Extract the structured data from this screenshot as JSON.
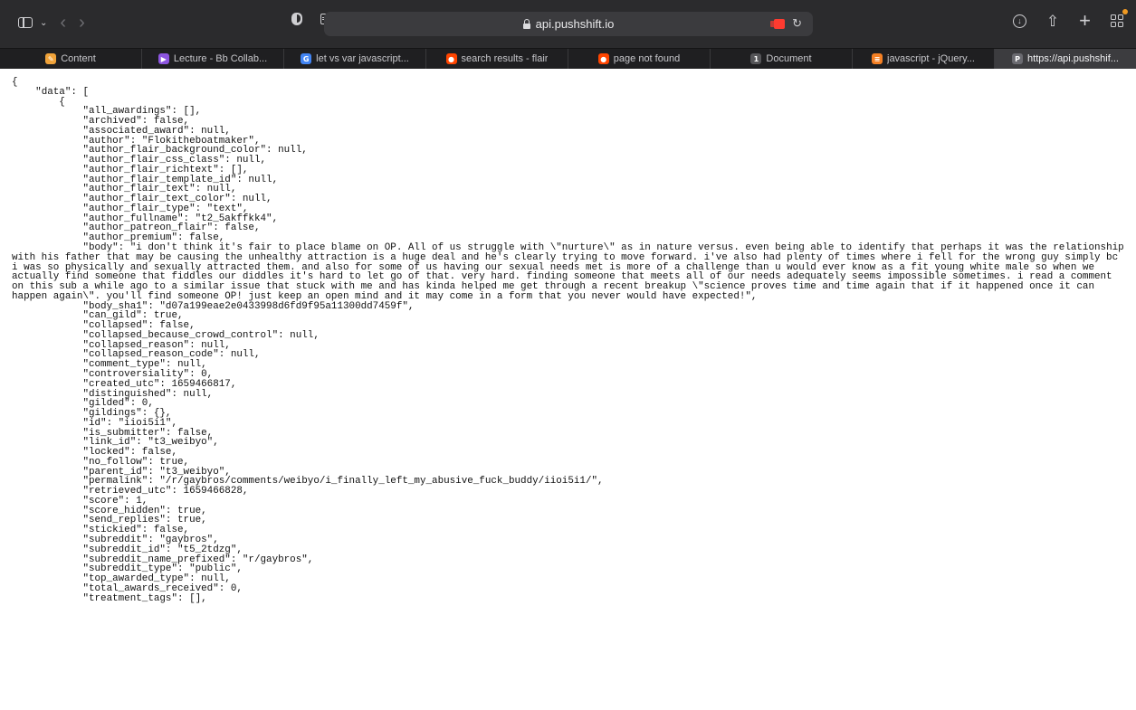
{
  "browser": {
    "url": "api.pushshift.io",
    "icons": {
      "sidebar": "sidebar-toggle-icon",
      "back": "back-arrow-icon",
      "forward": "forward-arrow-icon",
      "privacy": "shield-icon",
      "reader": "page-icon",
      "lock": "lock-icon",
      "camera": "camera-icon",
      "reload": "reload-icon",
      "download": "download-icon",
      "share": "share-icon",
      "new_tab": "plus-icon",
      "tab_overview": "grid-icon"
    },
    "glyphs": {
      "back": "‹",
      "forward": "›",
      "chevron": "⌄",
      "reload": "↻",
      "download": "↓",
      "share": "⇧",
      "plus": "+"
    }
  },
  "tabs": [
    {
      "label": "Content",
      "icon_char": "✎",
      "icon_color": "#f0a33a"
    },
    {
      "label": "Lecture - Bb Collab...",
      "icon_char": "▶",
      "icon_color": "#8d55e0"
    },
    {
      "label": "let vs var javascript...",
      "icon_char": "G",
      "icon_color": "#4285f4"
    },
    {
      "label": "search results - flair",
      "icon_char": "●",
      "icon_color": "#ff4500"
    },
    {
      "label": "page not found",
      "icon_char": "●",
      "icon_color": "#ff4500"
    },
    {
      "label": "Document",
      "icon_char": "1",
      "icon_color": "#555558"
    },
    {
      "label": "javascript - jQuery...",
      "icon_char": "≡",
      "icon_color": "#f48024"
    },
    {
      "label": "https://api.pushshif...",
      "icon_char": "P",
      "icon_color": "#6a6a70"
    }
  ],
  "active_tab_index": 7,
  "json_text": "{\n    \"data\": [\n        {\n            \"all_awardings\": [],\n            \"archived\": false,\n            \"associated_award\": null,\n            \"author\": \"Flokitheboatmaker\",\n            \"author_flair_background_color\": null,\n            \"author_flair_css_class\": null,\n            \"author_flair_richtext\": [],\n            \"author_flair_template_id\": null,\n            \"author_flair_text\": null,\n            \"author_flair_text_color\": null,\n            \"author_flair_type\": \"text\",\n            \"author_fullname\": \"t2_5akffkk4\",\n            \"author_patreon_flair\": false,\n            \"author_premium\": false,\n            \"body\": \"i don't think it's fair to place blame on OP. All of us struggle with \\\"nurture\\\" as in nature versus. even being able to identify that perhaps it was the relationship with his father that may be causing the unhealthy attraction is a huge deal and he's clearly trying to move forward. i've also had plenty of times where i fell for the wrong guy simply bc i was so physically and sexually attracted them. and also for some of us having our sexual needs met is more of a challenge than u would ever know as a fit young white male so when we actually find someone that fiddles our diddles it's hard to let go of that. very hard. finding someone that meets all of our needs adequately seems impossible sometimes. i read a comment on this sub a while ago to a similar issue that stuck with me and has kinda helped me get through a recent breakup \\\"science proves time and time again that if it happened once it can happen again\\\". you'll find someone OP! just keep an open mind and it may come in a form that you never would have expected!\",\n            \"body_sha1\": \"d07a199eae2e0433998d6fd9f95a11300dd7459f\",\n            \"can_gild\": true,\n            \"collapsed\": false,\n            \"collapsed_because_crowd_control\": null,\n            \"collapsed_reason\": null,\n            \"collapsed_reason_code\": null,\n            \"comment_type\": null,\n            \"controversiality\": 0,\n            \"created_utc\": 1659466817,\n            \"distinguished\": null,\n            \"gilded\": 0,\n            \"gildings\": {},\n            \"id\": \"iioi5i1\",\n            \"is_submitter\": false,\n            \"link_id\": \"t3_weibyo\",\n            \"locked\": false,\n            \"no_follow\": true,\n            \"parent_id\": \"t3_weibyo\",\n            \"permalink\": \"/r/gaybros/comments/weibyo/i_finally_left_my_abusive_fuck_buddy/iioi5i1/\",\n            \"retrieved_utc\": 1659466828,\n            \"score\": 1,\n            \"score_hidden\": true,\n            \"send_replies\": true,\n            \"stickied\": false,\n            \"subreddit\": \"gaybros\",\n            \"subreddit_id\": \"t5_2tdzg\",\n            \"subreddit_name_prefixed\": \"r/gaybros\",\n            \"subreddit_type\": \"public\",\n            \"top_awarded_type\": null,\n            \"total_awards_received\": 0,\n            \"treatment_tags\": [],"
}
